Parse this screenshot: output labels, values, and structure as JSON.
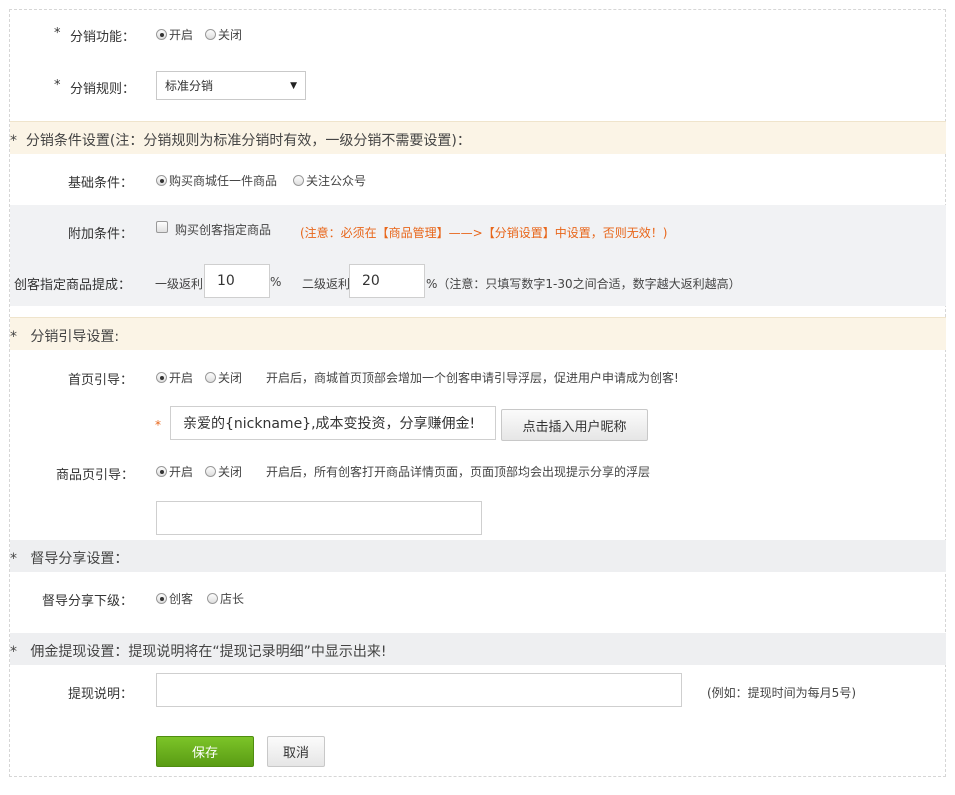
{
  "distribution_function": {
    "label": "分销功能：",
    "options": [
      "开启",
      "关闭"
    ],
    "selected": 0
  },
  "distribution_rule": {
    "label": "分销规则：",
    "value": "标准分销"
  },
  "condition_section": {
    "title": "分销条件设置(注：分销规则为标准分销时有效，一级分销不需要设置)："
  },
  "basic_condition": {
    "label": "基础条件：",
    "options": [
      "购买商城任一件商品",
      "关注公众号"
    ],
    "selected": 0
  },
  "extra_condition": {
    "label": "附加条件：",
    "checkbox_label": "购买创客指定商品",
    "warning": "(注意：必须在【商品管理】——>【分销设置】中设置，否则无效！)"
  },
  "commission": {
    "label": "创客指定商品提成：",
    "level1_label": "一级返利",
    "level1_value": "10",
    "level1_unit": "%",
    "level2_label": "二级返利",
    "level2_value": "20",
    "level2_unit": "%（注意：只填写数字1-30之间合适，数字越大返利越高）"
  },
  "guide_section": {
    "title": "分销引导设置:"
  },
  "home_guide": {
    "label": "首页引导：",
    "options": [
      "开启",
      "关闭"
    ],
    "selected": 0,
    "description": "开启后，商城首页顶部会增加一个创客申请引导浮层，促进用户申请成为创客!",
    "message_value": "亲爱的{nickname},成本变投资，分享赚佣金!",
    "insert_button": "点击插入用户昵称"
  },
  "product_guide": {
    "label": "商品页引导：",
    "options": [
      "开启",
      "关闭"
    ],
    "selected": 0,
    "description": "开启后，所有创客打开商品详情页面，页面顶部均会出现提示分享的浮层",
    "message_value": ""
  },
  "supervise_section": {
    "title": "督导分享设置："
  },
  "supervise": {
    "label": "督导分享下级：",
    "options": [
      "创客",
      "店长"
    ],
    "selected": 0
  },
  "withdraw_section": {
    "title": "佣金提现设置：提现说明将在“提现记录明细”中显示出来!"
  },
  "withdraw": {
    "label": "提现说明：",
    "value": "",
    "example": "(例如：提现时间为每月5号)"
  },
  "actions": {
    "save": "保存",
    "cancel": "取消"
  },
  "colors": {
    "accent_green": "#6aaf1c",
    "warning_orange": "#e8661a",
    "section_cream": "#fbf4e6",
    "row_gray": "#f1f2f4"
  }
}
